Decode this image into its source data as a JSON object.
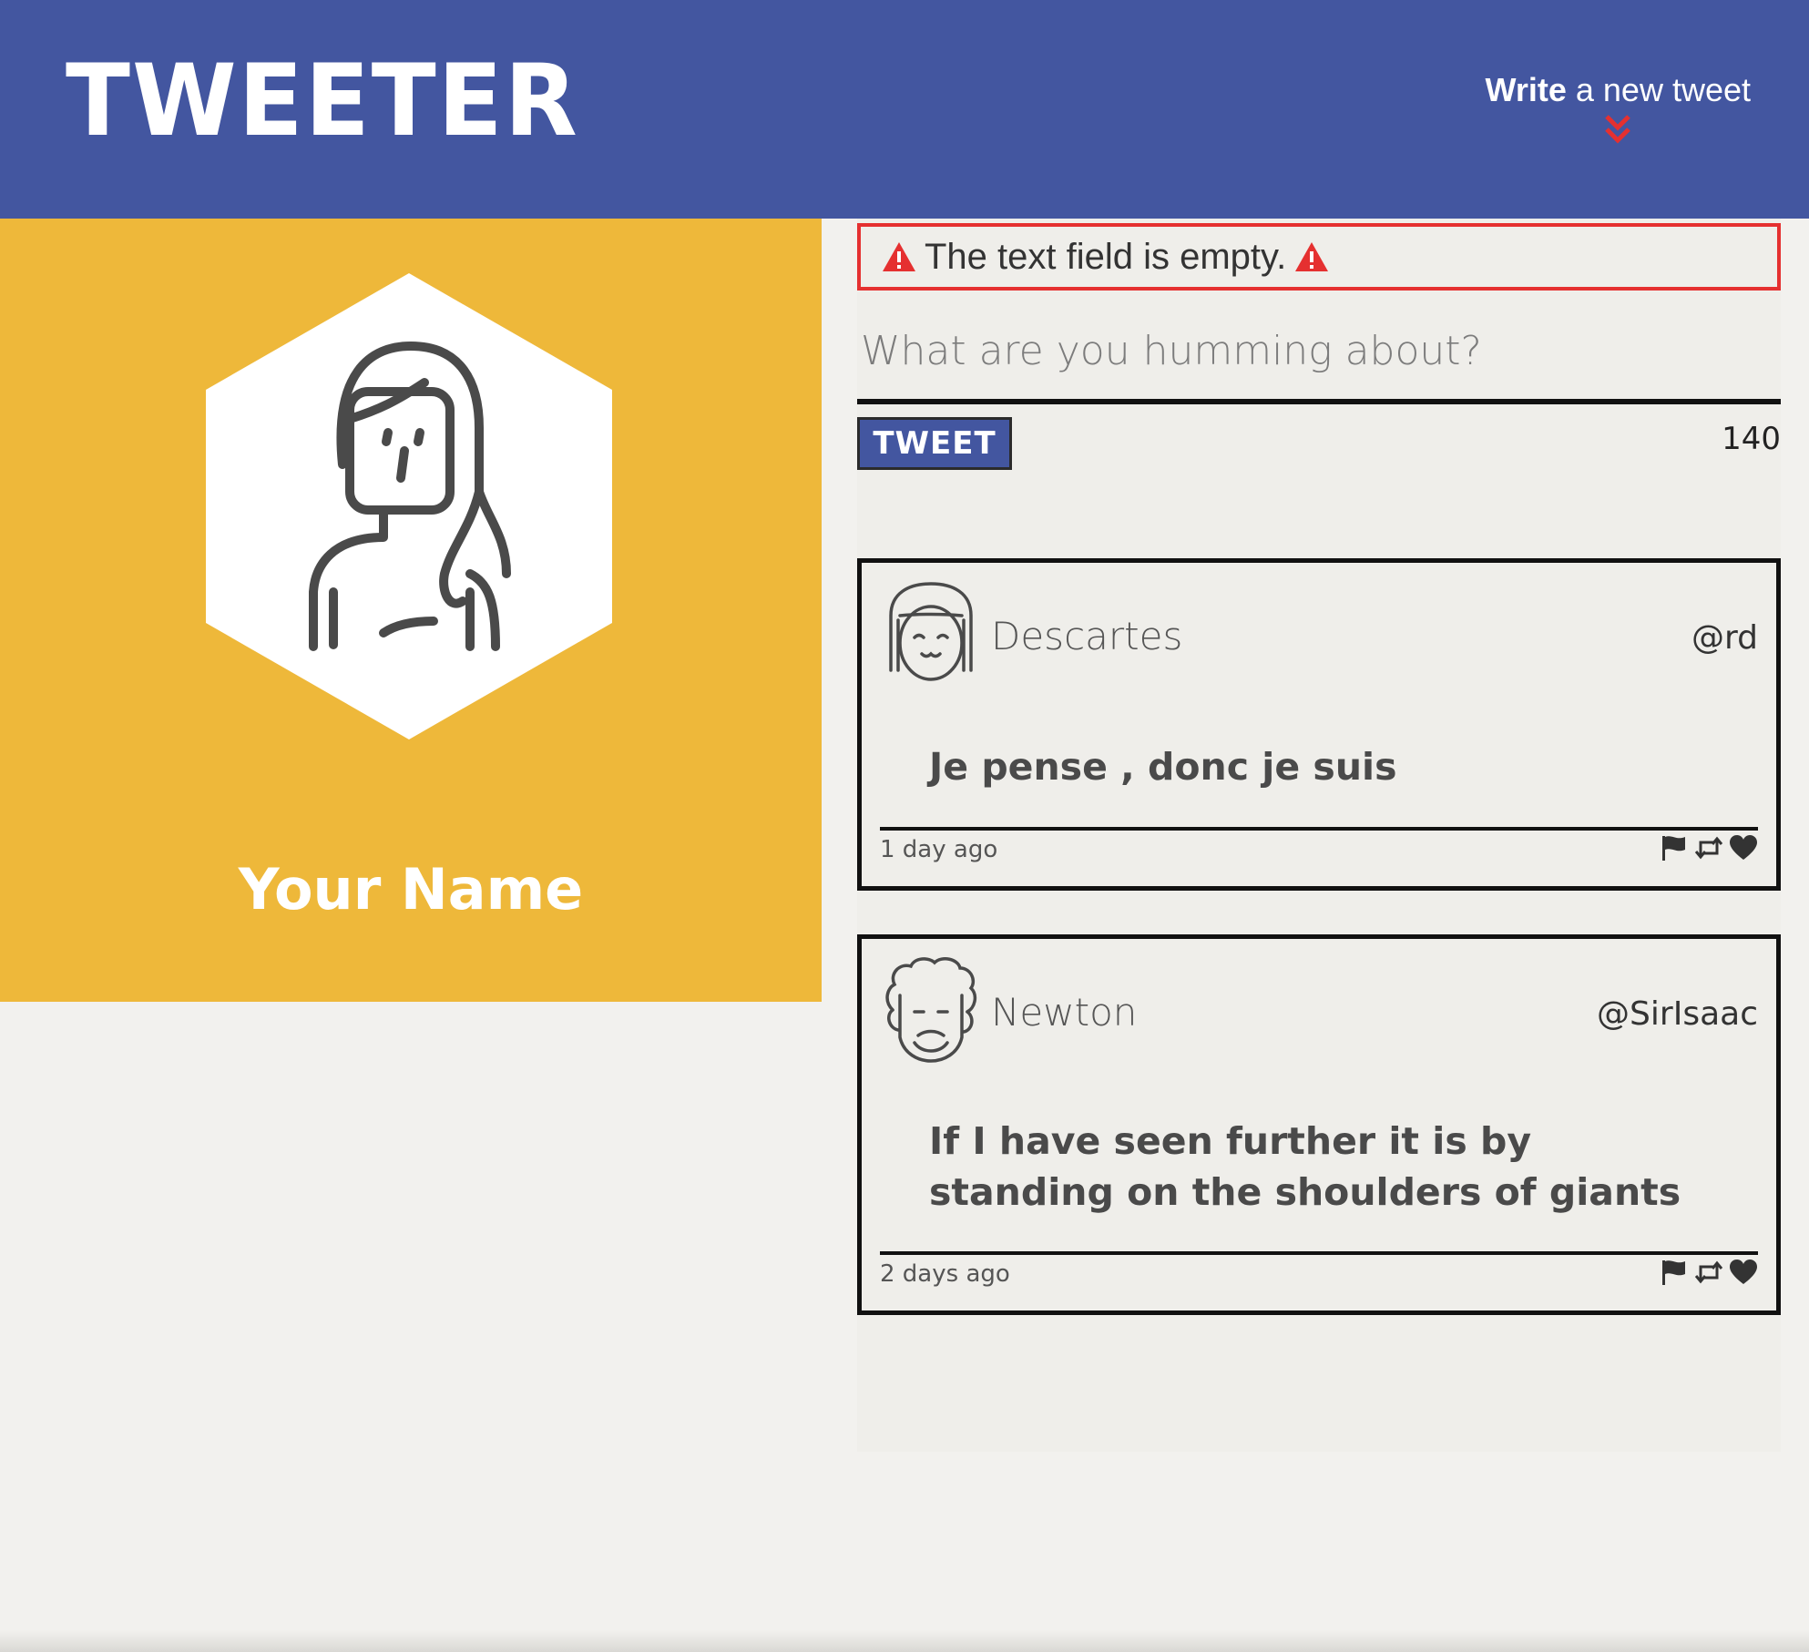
{
  "header": {
    "logo": "TWEETER",
    "compose_strong": "Write",
    "compose_rest": " a new tweet",
    "background_color": "#4356a0",
    "chevron_icon": "double-chevron-down-icon",
    "chevron_color": "#e53030"
  },
  "profile": {
    "name": "Your Name",
    "background_color": "#eeb83a",
    "avatar_icon": "woman-avatar-icon"
  },
  "composer": {
    "error_text": "The text field is empty.",
    "error_icon": "warning-icon",
    "error_color": "#e53030",
    "placeholder": "What are you humming about?",
    "value": "",
    "button_label": "TWEET",
    "counter": "140"
  },
  "tweets": [
    {
      "name": "Descartes",
      "handle": "@rd",
      "content": "Je pense , donc je suis",
      "time": "1 day ago",
      "avatar_icon": "descartes-avatar-icon",
      "actions": [
        "flag-icon",
        "retweet-icon",
        "heart-icon"
      ]
    },
    {
      "name": "Newton",
      "handle": "@SirIsaac",
      "content": "If I have seen further it is by standing on the shoulders of giants",
      "time": "2 days ago",
      "avatar_icon": "newton-avatar-icon",
      "actions": [
        "flag-icon",
        "retweet-icon",
        "heart-icon"
      ]
    }
  ]
}
